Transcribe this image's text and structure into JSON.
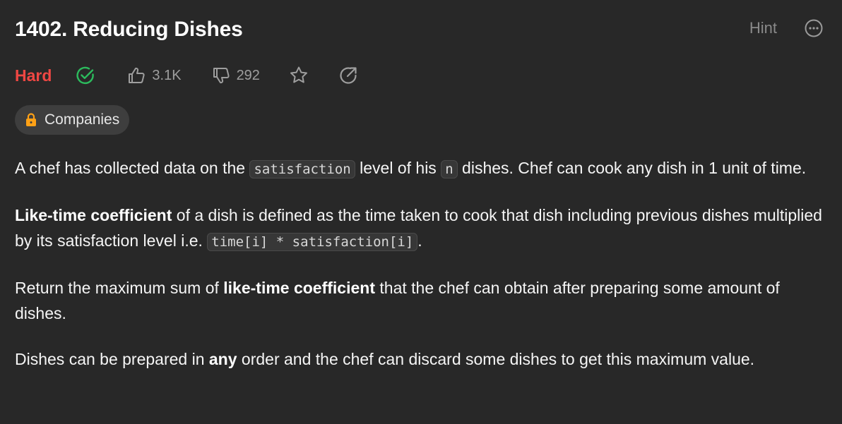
{
  "problem": {
    "title": "1402. Reducing Dishes",
    "difficulty": "Hard",
    "difficulty_color": "#ef4743",
    "solved_icon": "check-circle-icon",
    "likes": "3.1K",
    "dislikes": "292"
  },
  "header": {
    "hint_label": "Hint",
    "more_icon": "more-horizontal-icon"
  },
  "tags": {
    "companies_label": "Companies",
    "lock_icon": "lock-icon"
  },
  "description": {
    "p1": {
      "t1": "A chef has collected data on the ",
      "code1": "satisfaction",
      "t2": " level of his ",
      "code2": "n",
      "t3": " dishes. Chef can cook any dish in 1 unit of time."
    },
    "p2": {
      "bold1": "Like-time coefficient",
      "t1": " of a dish is defined as the time taken to cook that dish including previous dishes multiplied by its satisfaction level i.e. ",
      "code1": "time[i] * satisfaction[i]",
      "t2": "."
    },
    "p3": {
      "t1": "Return the maximum sum of ",
      "bold1": "like-time coefficient",
      "t2": " that the chef can obtain after preparing some amount of dishes."
    },
    "p4": {
      "t1": "Dishes can be prepared in ",
      "bold1": "any",
      "t2": " order and the chef can discard some dishes to get this maximum value."
    }
  }
}
